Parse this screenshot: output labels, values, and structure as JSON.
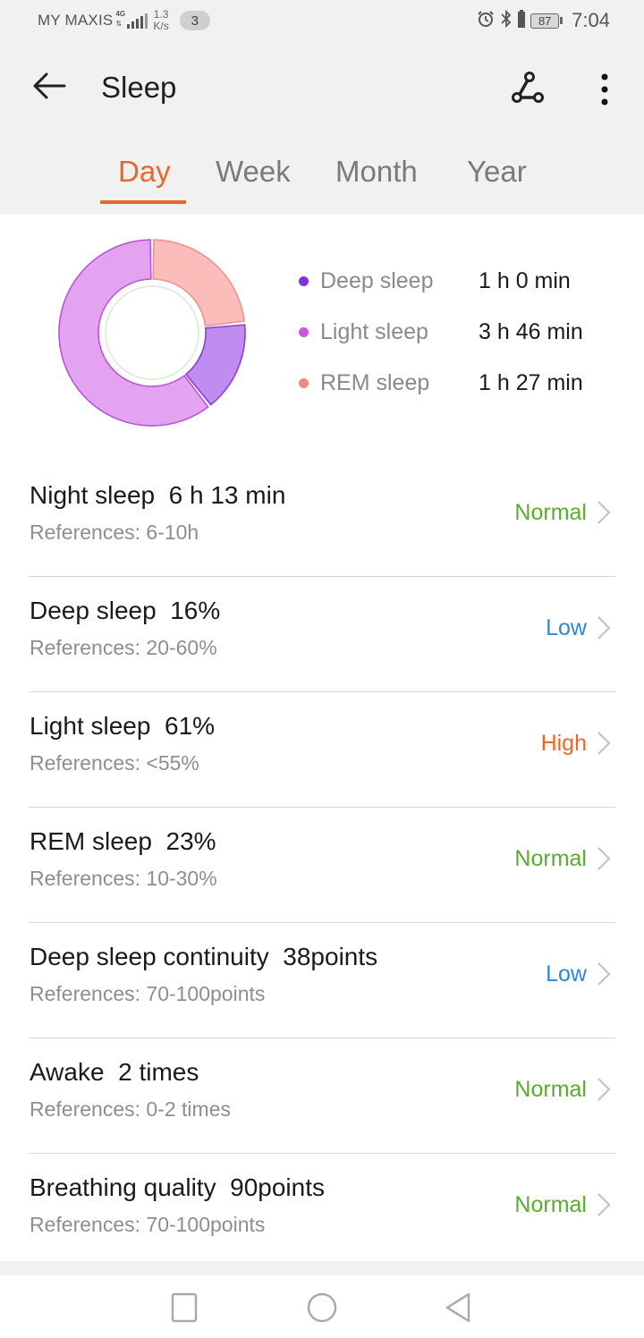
{
  "status_bar": {
    "carrier": "MY MAXIS",
    "network_type": "4G",
    "speed_value": "1.3",
    "speed_unit": "K/s",
    "notification_count": "3",
    "battery_level": "87",
    "time": "7:04",
    "icons": [
      "signal-icon",
      "alarm-icon",
      "bluetooth-icon",
      "battery-icon"
    ]
  },
  "app_bar": {
    "title": "Sleep",
    "back_icon": "arrow-left-icon",
    "share_icon": "share-nodes-icon",
    "more_icon": "more-vertical-icon"
  },
  "tabs": [
    {
      "label": "Day",
      "active": true
    },
    {
      "label": "Week",
      "active": false
    },
    {
      "label": "Month",
      "active": false
    },
    {
      "label": "Year",
      "active": false
    }
  ],
  "colors": {
    "accent": "#e8672a",
    "normal": "#5bab2e",
    "low": "#2d86d6",
    "high": "#e8672a",
    "deep": "#7b35d9",
    "light": "#c856e3",
    "rem": "#f08782"
  },
  "chart_data": {
    "type": "pie",
    "variant": "donut",
    "title": "",
    "start": "top",
    "direction": "clockwise",
    "segments": [
      {
        "name": "REM sleep",
        "value_min": 87,
        "display": "1 h 27 min",
        "percent": 23
      },
      {
        "name": "Deep sleep",
        "value_min": 60,
        "display": "1 h 0 min",
        "percent": 16
      },
      {
        "name": "Light sleep",
        "value_min": 226,
        "display": "3 h 46 min",
        "percent": 61
      }
    ],
    "legend": [
      {
        "label": "Deep sleep",
        "value": "1 h 0 min",
        "color": "#7b35d9"
      },
      {
        "label": "Light sleep",
        "value": "3 h 46 min",
        "color": "#c856e3"
      },
      {
        "label": "REM sleep",
        "value": "1 h 27 min",
        "color": "#f08782"
      }
    ],
    "legend_position": "right"
  },
  "metrics": [
    {
      "title": "Night sleep  6 h 13 min",
      "reference": "References: 6-10h",
      "status": "Normal",
      "status_type": "normal"
    },
    {
      "title": "Deep sleep  16%",
      "reference": "References: 20-60%",
      "status": "Low",
      "status_type": "low"
    },
    {
      "title": "Light sleep  61%",
      "reference": "References: <55%",
      "status": "High",
      "status_type": "high"
    },
    {
      "title": "REM sleep  23%",
      "reference": "References: 10-30%",
      "status": "Normal",
      "status_type": "normal"
    },
    {
      "title": "Deep sleep continuity  38points",
      "reference": "References: 70-100points",
      "status": "Low",
      "status_type": "low"
    },
    {
      "title": "Awake  2 times",
      "reference": "References: 0-2 times",
      "status": "Normal",
      "status_type": "normal"
    },
    {
      "title": "Breathing quality  90points",
      "reference": "References: 70-100points",
      "status": "Normal",
      "status_type": "normal"
    }
  ],
  "nav_bar": {
    "buttons": [
      "recent-apps",
      "home",
      "back"
    ]
  }
}
